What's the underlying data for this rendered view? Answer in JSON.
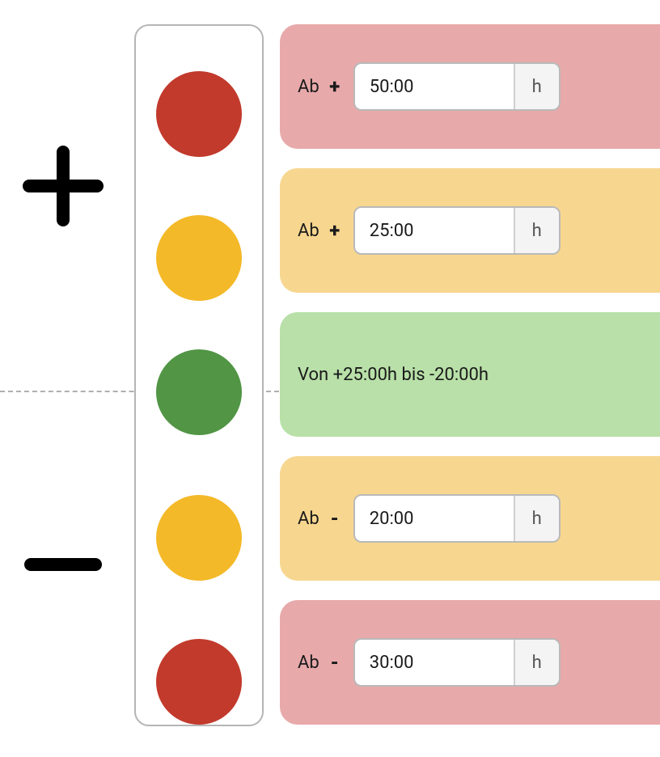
{
  "colors": {
    "red": "#c23a2c",
    "yellow": "#f4b928",
    "green": "#519545",
    "card_red": "#e8a9aa",
    "card_yellow": "#f7d790",
    "card_green": "#b8e0a8"
  },
  "labels": {
    "ab": "Ab",
    "unit": "h"
  },
  "rows": {
    "red_top": {
      "sign": "+",
      "value": "50:00"
    },
    "yellow_top": {
      "sign": "+",
      "value": "25:00"
    },
    "green": {
      "text": "Von +25:00h bis -20:00h"
    },
    "yellow_bot": {
      "sign": "-",
      "value": "20:00"
    },
    "red_bot": {
      "sign": "-",
      "value": "30:00"
    }
  }
}
